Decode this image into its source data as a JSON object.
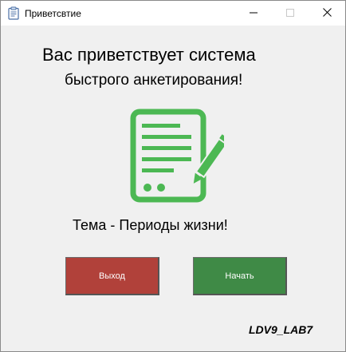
{
  "window": {
    "title": "Приветсвтие",
    "icon": "clipboard-icon"
  },
  "controls": {
    "minimize_icon": "minimize-icon",
    "maximize_icon": "maximize-icon",
    "close_icon": "close-icon"
  },
  "greeting": {
    "line1": "Вас приветствует система",
    "line2": "быстрого анкетирования!"
  },
  "illustration": {
    "icon": "document-pencil-icon",
    "color": "#4cb853"
  },
  "topic": "Тема - Периоды жизни!",
  "buttons": {
    "exit_label": "Выход",
    "start_label": "Начать",
    "exit_color": "#b1413a",
    "start_color": "#3f8a46"
  },
  "signature": "LDV9_LAB7"
}
